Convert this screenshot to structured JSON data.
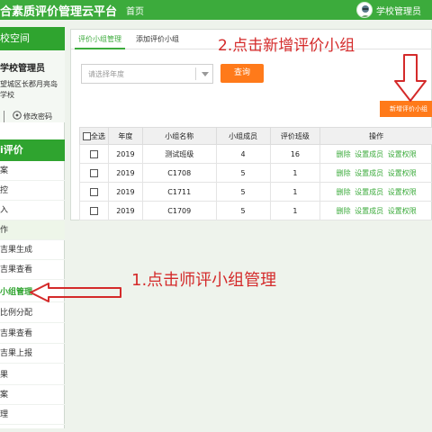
{
  "header": {
    "app_title": "合素质评价管理云平台",
    "nav_home": "首页",
    "user_name": "学校管理员"
  },
  "sidebar": {
    "space_title": "校空间",
    "school_name": "学校管理员",
    "address_line1": "望城区长郡月亮岛",
    "address_line2": "学校",
    "change_password": "修改密码",
    "menu_title": "i评价",
    "items": [
      {
        "label": "案"
      },
      {
        "label": "控"
      },
      {
        "label": "入"
      },
      {
        "label": "作"
      },
      {
        "label": "吉果生成"
      },
      {
        "label": "吉果查看"
      },
      {
        "label": "小组管理"
      },
      {
        "label": "比例分配"
      },
      {
        "label": "吉果查看"
      },
      {
        "label": "吉果上报"
      },
      {
        "label": "果"
      },
      {
        "label": "案"
      },
      {
        "label": "理"
      }
    ]
  },
  "main": {
    "tabs": [
      {
        "label": "评价小组管理"
      },
      {
        "label": "添加评价小组"
      }
    ],
    "year_select_placeholder": "请选择年度",
    "query_button": "查询",
    "add_group_button": "新增评价小组",
    "table": {
      "headers": [
        "全选",
        "年度",
        "小组名称",
        "小组成员",
        "评价班级",
        "操作"
      ],
      "rows": [
        {
          "year": "2019",
          "name": "测试班级",
          "members": "4",
          "classes": "16"
        },
        {
          "year": "2019",
          "name": "C1708",
          "members": "5",
          "classes": "1"
        },
        {
          "year": "2019",
          "name": "C1711",
          "members": "5",
          "classes": "1"
        },
        {
          "year": "2019",
          "name": "C1709",
          "members": "5",
          "classes": "1"
        }
      ],
      "actions": [
        "删除",
        "设置成员",
        "设置权限"
      ]
    }
  },
  "annotations": {
    "step1": "1.点击师评小组管理",
    "step2": "2.点击新增评价小组"
  },
  "colors": {
    "header_green": "#3cab3c",
    "accent_orange": "#ff7a1a",
    "annotation_red": "#d42a2a",
    "action_green": "#3cab3c"
  }
}
